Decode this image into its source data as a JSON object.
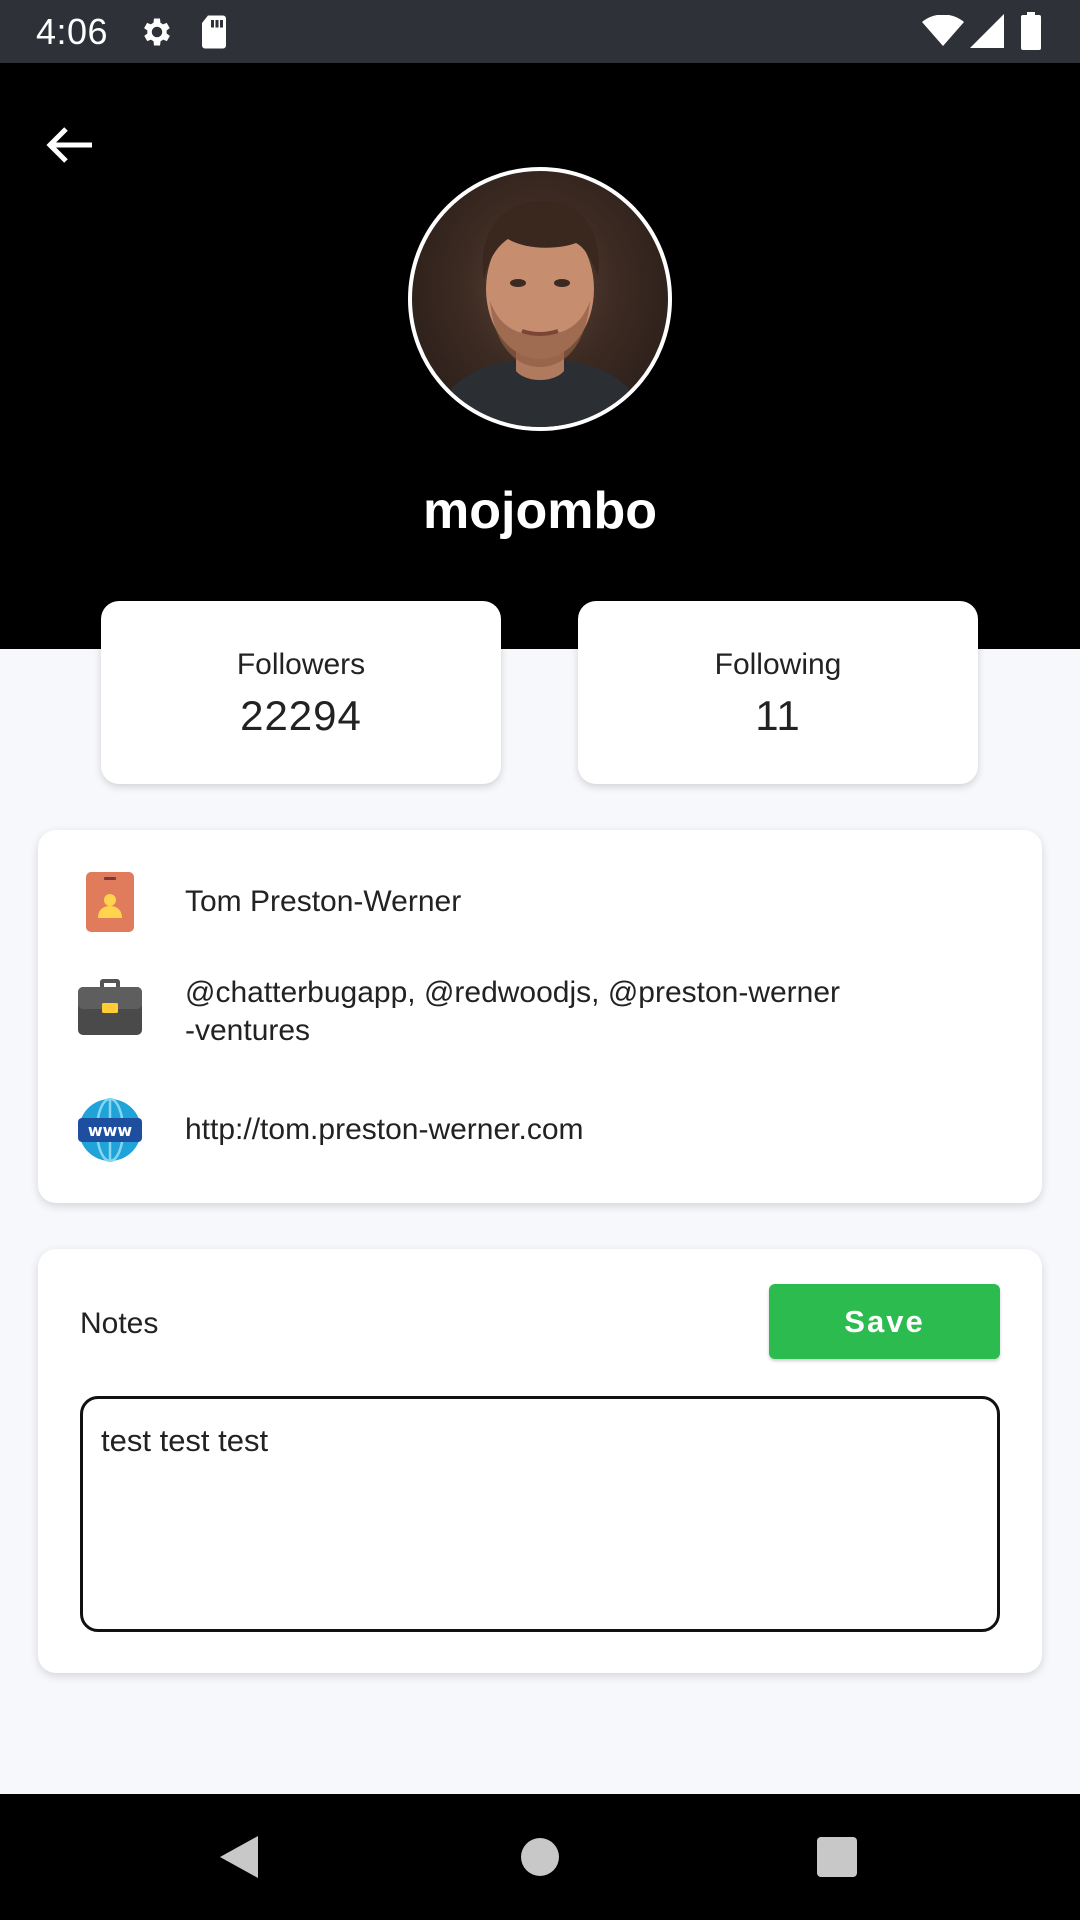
{
  "status_bar": {
    "time": "4:06",
    "icons": [
      "settings-icon",
      "sd-card-icon",
      "wifi-icon",
      "signal-icon",
      "battery-icon"
    ]
  },
  "header": {
    "back_icon": "arrow-left-icon",
    "username": "mojombo",
    "background_color": "#000000"
  },
  "stats": {
    "followers_label": "Followers",
    "followers_value": "22294",
    "following_label": "Following",
    "following_value": "11"
  },
  "info": {
    "name": "Tom Preston-Werner",
    "company_line1": "@chatterbugapp, @redwoodjs, @preston-werner",
    "company_line2": "-ventures",
    "website": "http://tom.preston-werner.com",
    "icons": [
      "id-badge-icon",
      "briefcase-icon",
      "www-globe-icon"
    ]
  },
  "notes": {
    "label": "Notes",
    "save_label": "Save",
    "value": "test test test"
  },
  "colors": {
    "save_button": "#2bbb4f",
    "page_background": "#f7f8fb",
    "status_bar": "#2e3138"
  },
  "nav_bar": {
    "icons": [
      "back-triangle-icon",
      "home-circle-icon",
      "recents-square-icon"
    ]
  }
}
